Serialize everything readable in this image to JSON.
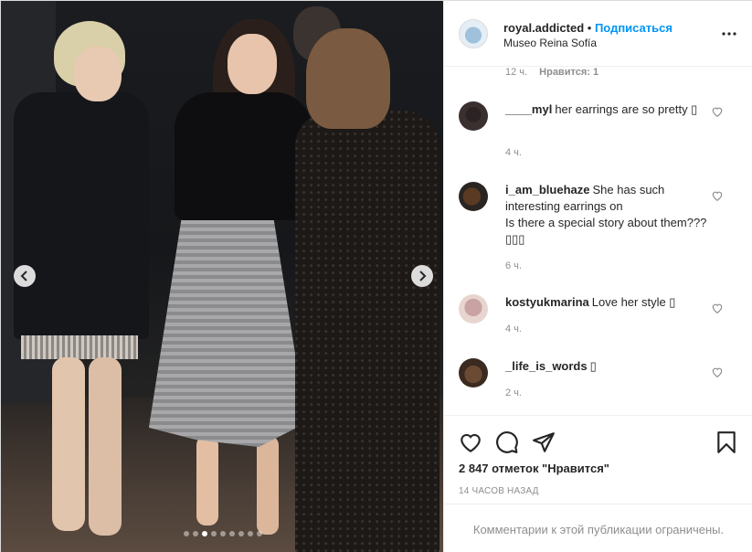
{
  "post": {
    "username": "royal.addicted",
    "separator": "•",
    "follow_label": "Подписаться",
    "location": "Museo Reina Sofía"
  },
  "caption_meta": {
    "time": "12 ч.",
    "likes": "Нравится: 1"
  },
  "comments": [
    {
      "username": "____myl",
      "text": "her earrings are so pretty ▯",
      "time": "4 ч."
    },
    {
      "username": "i_am_bluehaze",
      "text": "She has such interesting earrings on",
      "text2": "Is there a special story about them???▯▯▯",
      "time": "6 ч."
    },
    {
      "username": "kostyukmarina",
      "text": "Love her style ▯",
      "time": "4 ч."
    },
    {
      "username": "_life_is_words",
      "text": "▯",
      "time": "2 ч."
    }
  ],
  "actions": {
    "like_icon": "heart-outline-icon",
    "comment_icon": "speech-bubble-icon",
    "share_icon": "paper-plane-icon",
    "save_icon": "bookmark-icon"
  },
  "likes_count": "2 847 отметок \"Нравится\"",
  "time_ago": "14 ЧАСОВ НАЗАД",
  "comments_limited": "Комментарии к этой публикации ограничены.",
  "carousel": {
    "total": 9,
    "current": 3
  },
  "colors": {
    "accent": "#0095f6",
    "muted": "#8e8e8e",
    "text": "#262626",
    "border": "#efefef"
  }
}
